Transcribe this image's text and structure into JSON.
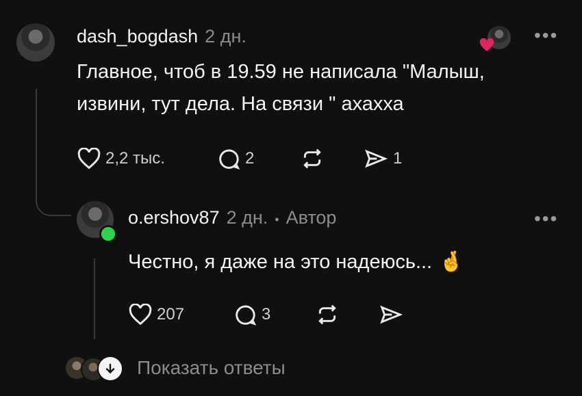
{
  "comment": {
    "username": "dash_bogdash",
    "time": "2 дн.",
    "text_line1": "Главное,  чтоб в 19.59 не написала \"Малыш,",
    "text_line2": "извини,  тут дела. На связи \" ахахха",
    "likes": "2,2 тыс.",
    "replies": "2",
    "shares": "1"
  },
  "reply": {
    "username": "o.ershov87",
    "time": "2 дн.",
    "separator": "•",
    "author_badge": "Автор",
    "text": "Честно, я даже на это надеюсь...",
    "emoji": "🤞",
    "likes": "207",
    "replies": "3"
  },
  "footer": {
    "show_replies_label": "Показать ответы"
  },
  "colors": {
    "background": "#101010",
    "text": "#f3f5f7",
    "muted": "#8c8c8c",
    "online": "#2bd44a",
    "heart": "#e0245e"
  },
  "icons": [
    "heart-icon",
    "comment-icon",
    "repost-icon",
    "share-icon",
    "more-icon",
    "arrow-down-icon"
  ]
}
